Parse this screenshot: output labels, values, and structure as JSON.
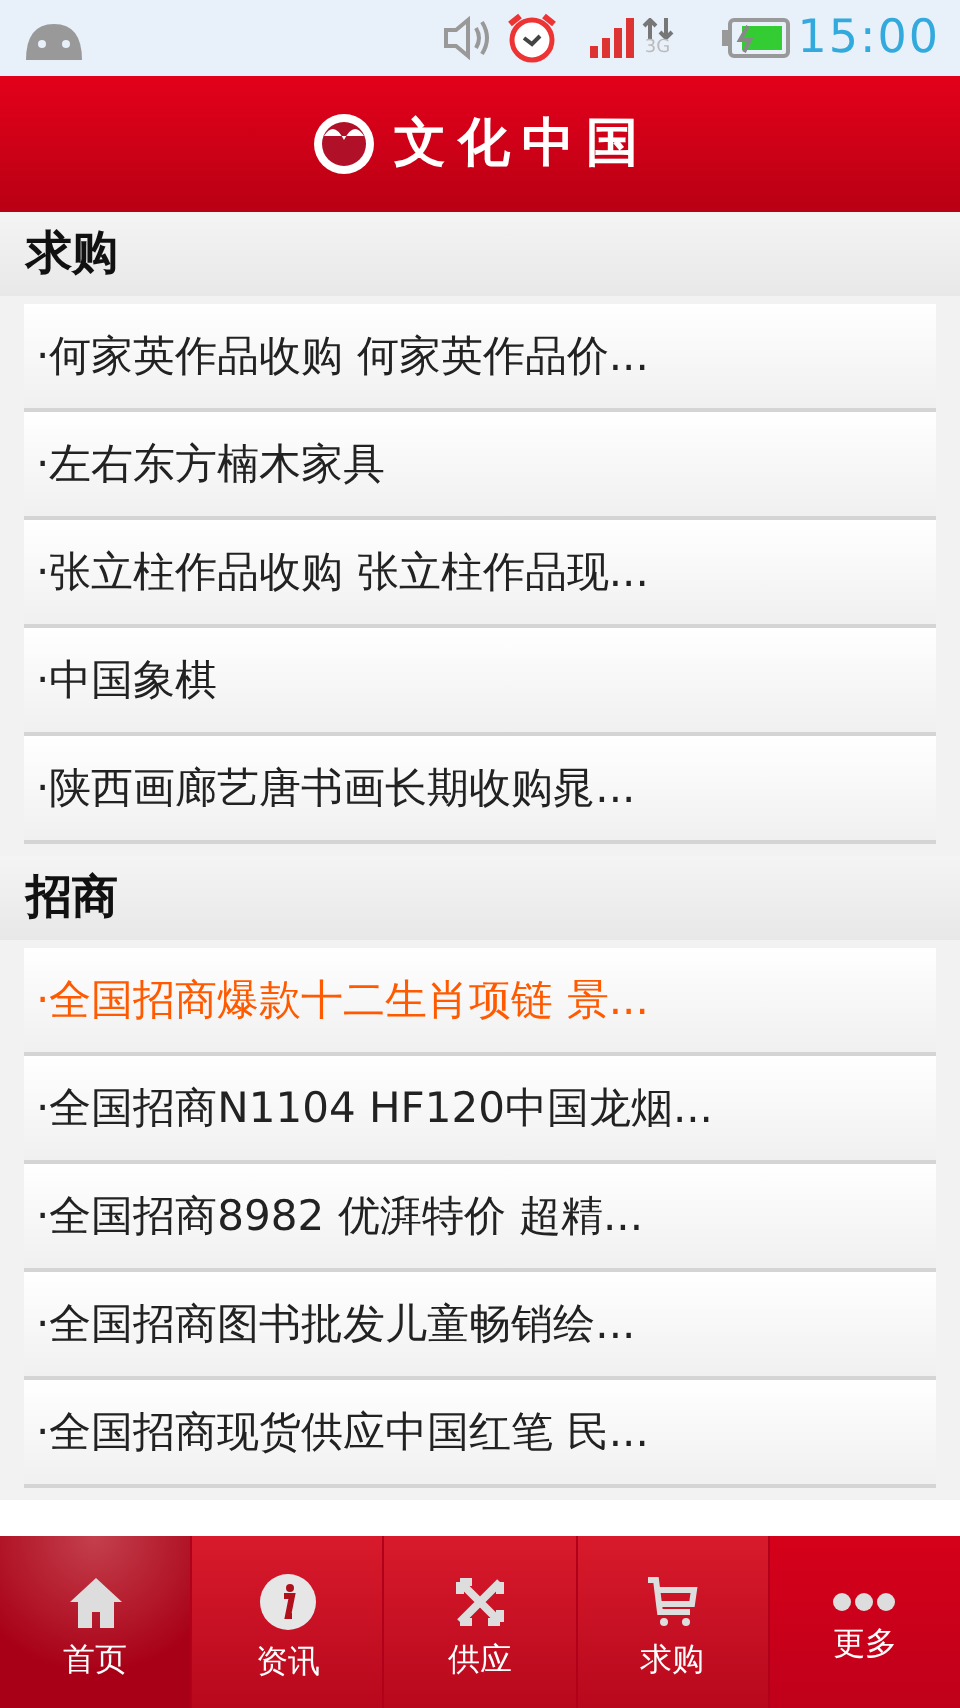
{
  "status_bar": {
    "time": "15:00",
    "network": "3G"
  },
  "header": {
    "title": "文化中国"
  },
  "sections": [
    {
      "title": "求购",
      "items": [
        {
          "text": "·何家英作品收购 何家英作品价...",
          "highlighted": false
        },
        {
          "text": "·左右东方楠木家具",
          "highlighted": false
        },
        {
          "text": "·张立柱作品收购 张立柱作品现...",
          "highlighted": false
        },
        {
          "text": "·中国象棋",
          "highlighted": false
        },
        {
          "text": "·陕西画廊艺唐书画长期收购晁...",
          "highlighted": false
        }
      ]
    },
    {
      "title": "招商",
      "items": [
        {
          "text": "·全国招商爆款十二生肖项链 景...",
          "highlighted": true
        },
        {
          "text": "·全国招商N1104 HF120中国龙烟...",
          "highlighted": false
        },
        {
          "text": "·全国招商8982 优湃特价 超精...",
          "highlighted": false
        },
        {
          "text": "·全国招商图书批发儿童畅销绘...",
          "highlighted": false
        },
        {
          "text": "·全国招商现货供应中国红笔 民...",
          "highlighted": false
        }
      ]
    }
  ],
  "tabs": [
    {
      "label": "首页",
      "kind": "home",
      "selected": true
    },
    {
      "label": "资讯",
      "kind": "info",
      "selected": false
    },
    {
      "label": "供应",
      "kind": "supply",
      "selected": false
    },
    {
      "label": "求购",
      "kind": "cart",
      "selected": false
    },
    {
      "label": "更多",
      "kind": "more",
      "selected": false
    }
  ]
}
